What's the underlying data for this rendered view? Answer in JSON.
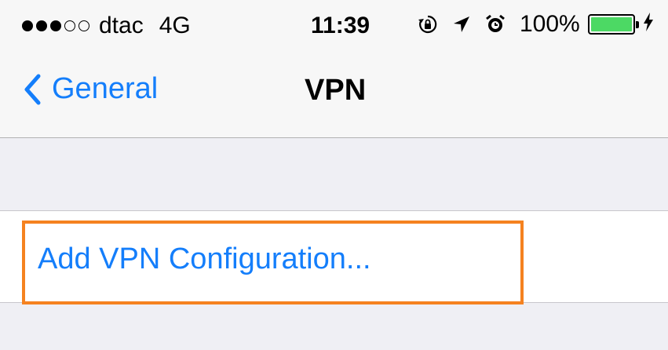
{
  "status_bar": {
    "signal_bars_filled": 3,
    "signal_bars_total": 5,
    "carrier": "dtac",
    "network": "4G",
    "time": "11:39",
    "icons": [
      "rotation-lock-icon",
      "location-arrow-icon",
      "alarm-icon"
    ],
    "battery_percent": "100%",
    "battery_level": 1.0,
    "battery_color": "#4cd964",
    "charging": true
  },
  "nav": {
    "back_label": "General",
    "title": "VPN"
  },
  "list": {
    "add_vpn_label": "Add VPN Configuration..."
  },
  "colors": {
    "accent": "#147efb",
    "highlight": "#f58220",
    "background": "#efeff4"
  }
}
